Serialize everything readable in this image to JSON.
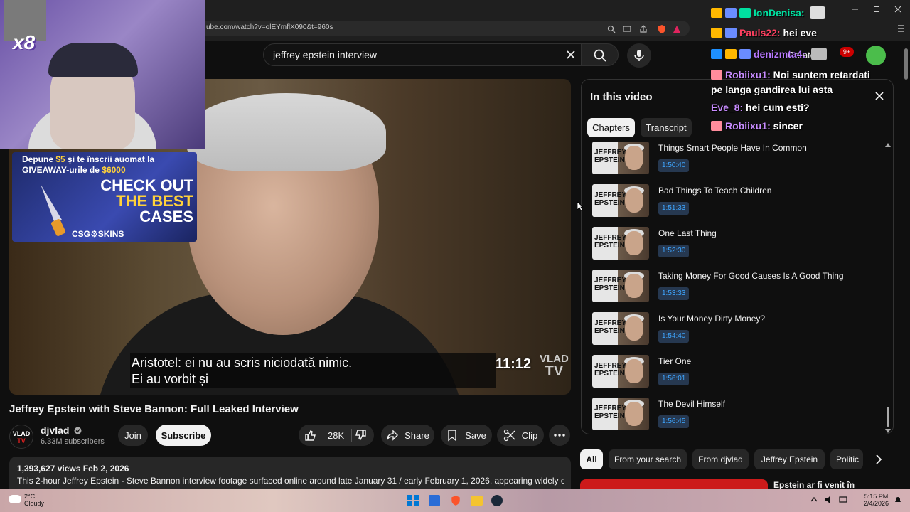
{
  "browser": {
    "url": "ube.com/watch?v=olEYmflX090&t=960s"
  },
  "search": {
    "query": "jeffrey epstein interview"
  },
  "header": {
    "create_label": "Create",
    "notif_count": "9+"
  },
  "player": {
    "subtitle": "Aristotel: ei nu au scris niciodată nimic.\nEi au vorbit și",
    "overlay_time": "11:12",
    "logo_line1": "VLAD",
    "logo_line2": "TV"
  },
  "stream_overlay": {
    "multiplier": "x8",
    "ad_line1_a": "Depune ",
    "ad_line1_amount": "$5",
    "ad_line1_b": " și te înscrii auomat la",
    "ad_line2_a": "GIVEAWAY-urile de ",
    "ad_line2_amount": "$6000",
    "ad_big1": "CHECK OUT",
    "ad_big2": "THE BEST",
    "ad_big3": "CASES",
    "ad_brand": "CSG⚙SKINS"
  },
  "video": {
    "title": "Jeffrey Epstein with Steve Bannon: Full Leaked Interview",
    "channel": "djvlad",
    "channel_avatar_line1": "VLAD",
    "channel_avatar_line2": "TV",
    "subscribers": "6.33M subscribers",
    "join_label": "Join",
    "subscribe_label": "Subscribe",
    "likes": "28K",
    "share_label": "Share",
    "save_label": "Save",
    "clip_label": "Clip",
    "views_date": "1,393,627 views  Feb 2, 2026",
    "description": "This 2-hour Jeffrey Epstein - Steve Bannon interview footage surfaced online around late January 31 / early February 1, 2026, appearing widely on"
  },
  "panel": {
    "title": "In this video",
    "tabs": [
      "Chapters",
      "Transcript"
    ],
    "chapters": [
      {
        "title": "Things Smart People Have In Common",
        "time": "1:50:40",
        "thumb_line1": "JEFFREY",
        "thumb_line2": "EPSTEIN"
      },
      {
        "title": "Bad Things To Teach Children",
        "time": "1:51:33",
        "thumb_line1": "JEFFREY",
        "thumb_line2": "EPSTEIN"
      },
      {
        "title": "One Last Thing",
        "time": "1:52:30",
        "thumb_line1": "JEFFREY",
        "thumb_line2": "EPSTEIN"
      },
      {
        "title": "Taking Money For Good Causes Is A Good Thing",
        "time": "1:53:33",
        "thumb_line1": "JEFFREY",
        "thumb_line2": "EPSTEIN"
      },
      {
        "title": "Is Your Money Dirty Money?",
        "time": "1:54:40",
        "thumb_line1": "JEFFREY",
        "thumb_line2": "EPSTEIN"
      },
      {
        "title": "Tier One",
        "time": "1:56:01",
        "thumb_line1": "JEFFREY",
        "thumb_line2": "EPSTEIN"
      },
      {
        "title": "The Devil Himself",
        "time": "1:56:45",
        "thumb_line1": "JEFFREY",
        "thumb_line2": "EPSTEIN"
      }
    ]
  },
  "chips": [
    "All",
    "From your search",
    "From djvlad",
    "Jeffrey Epstein",
    "Politic"
  ],
  "recommended": {
    "title": "Epstein ar fi venit în"
  },
  "chat": [
    {
      "user": "IonDenisa:",
      "message": "",
      "color": "#00e0a0"
    },
    {
      "user": "Pauls22:",
      "message": "hei eve",
      "color": "#ff4060"
    },
    {
      "user": "denizmta4:",
      "message": "",
      "color": "#b878ff"
    },
    {
      "user": "Robiixu1:",
      "message": "Noi suntem retardati",
      "message2": "pe langa gandirea lui asta",
      "color": "#c88cff"
    },
    {
      "user": "Eve_8:",
      "message": "hei cum esti?",
      "color": "#c88cff"
    },
    {
      "user": "Robiixu1:",
      "message": "sincer",
      "color": "#c88cff"
    }
  ],
  "taskbar": {
    "temp": "2°C",
    "weather": "Cloudy",
    "time": "5:15 PM",
    "date": "2/4/2026"
  },
  "colors": {
    "accent_blue": "#3ea6ff",
    "bg": "#0f0f0f"
  }
}
